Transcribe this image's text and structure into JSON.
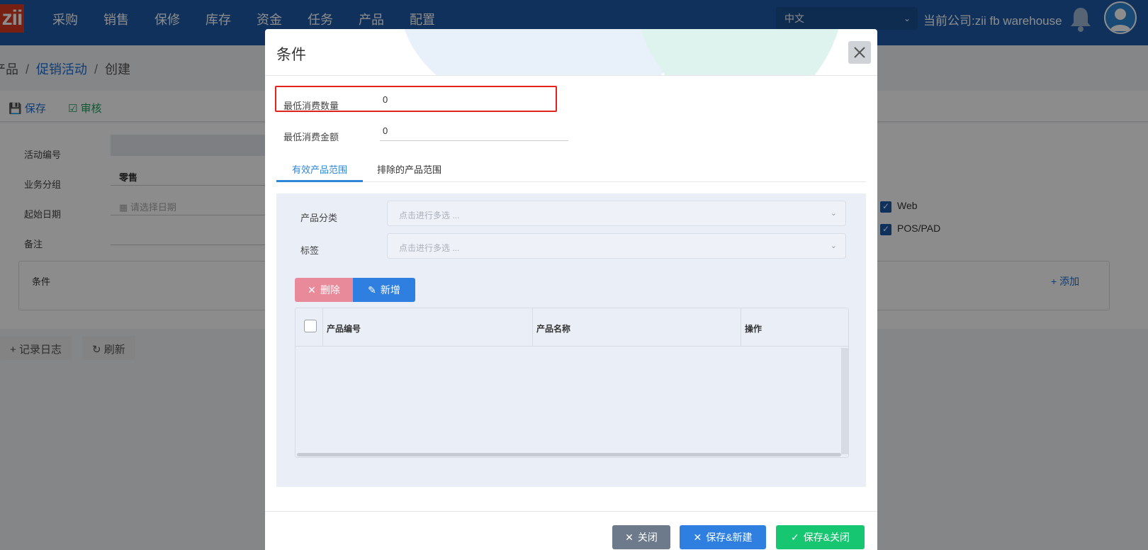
{
  "app": {
    "logo": "zii"
  },
  "nav": {
    "items": [
      "采购",
      "销售",
      "保修",
      "库存",
      "资金",
      "任务",
      "产品",
      "配置"
    ]
  },
  "header": {
    "language": "中文",
    "company": "当前公司:zii fb warehouse"
  },
  "breadcrumb": {
    "part1": "产品",
    "part2": "促销活动",
    "part3": "创建"
  },
  "toolbar": {
    "save": "保存",
    "approve": "审核"
  },
  "form": {
    "activity_no_label": "活动编号",
    "business_group_label": "业务分组",
    "business_group_value": "零售",
    "start_date_label": "起始日期",
    "start_date_placeholder": "请选择日期",
    "remark_label": "备注",
    "condition_label": "条件",
    "add_label": "添加",
    "channel_web": "Web",
    "channel_pos": "POS/PAD"
  },
  "bottom": {
    "log": "记录日志",
    "refresh": "刷新"
  },
  "modal": {
    "title": "条件",
    "min_qty_label": "最低消费数量",
    "min_qty_value": "0",
    "min_amount_label": "最低消费金额",
    "min_amount_value": "0",
    "tab_valid": "有效产品范围",
    "tab_excluded": "排除的产品范围",
    "category_label": "产品分类",
    "category_placeholder": "点击进行多选 ...",
    "tag_label": "标签",
    "tag_placeholder": "点击进行多选 ...",
    "delete_btn": "删除",
    "add_btn": "新增",
    "col_code": "产品编号",
    "col_name": "产品名称",
    "col_action": "操作",
    "close_btn": "关闭",
    "save_new_btn": "保存&新建",
    "save_close_btn": "保存&关闭"
  },
  "colors": {
    "primary": "#2f7fe0",
    "nav": "#1e5aa8",
    "danger": "#e98a9b",
    "success": "#17c671",
    "grey": "#6c7a8c",
    "highlight": "#e0231d"
  }
}
